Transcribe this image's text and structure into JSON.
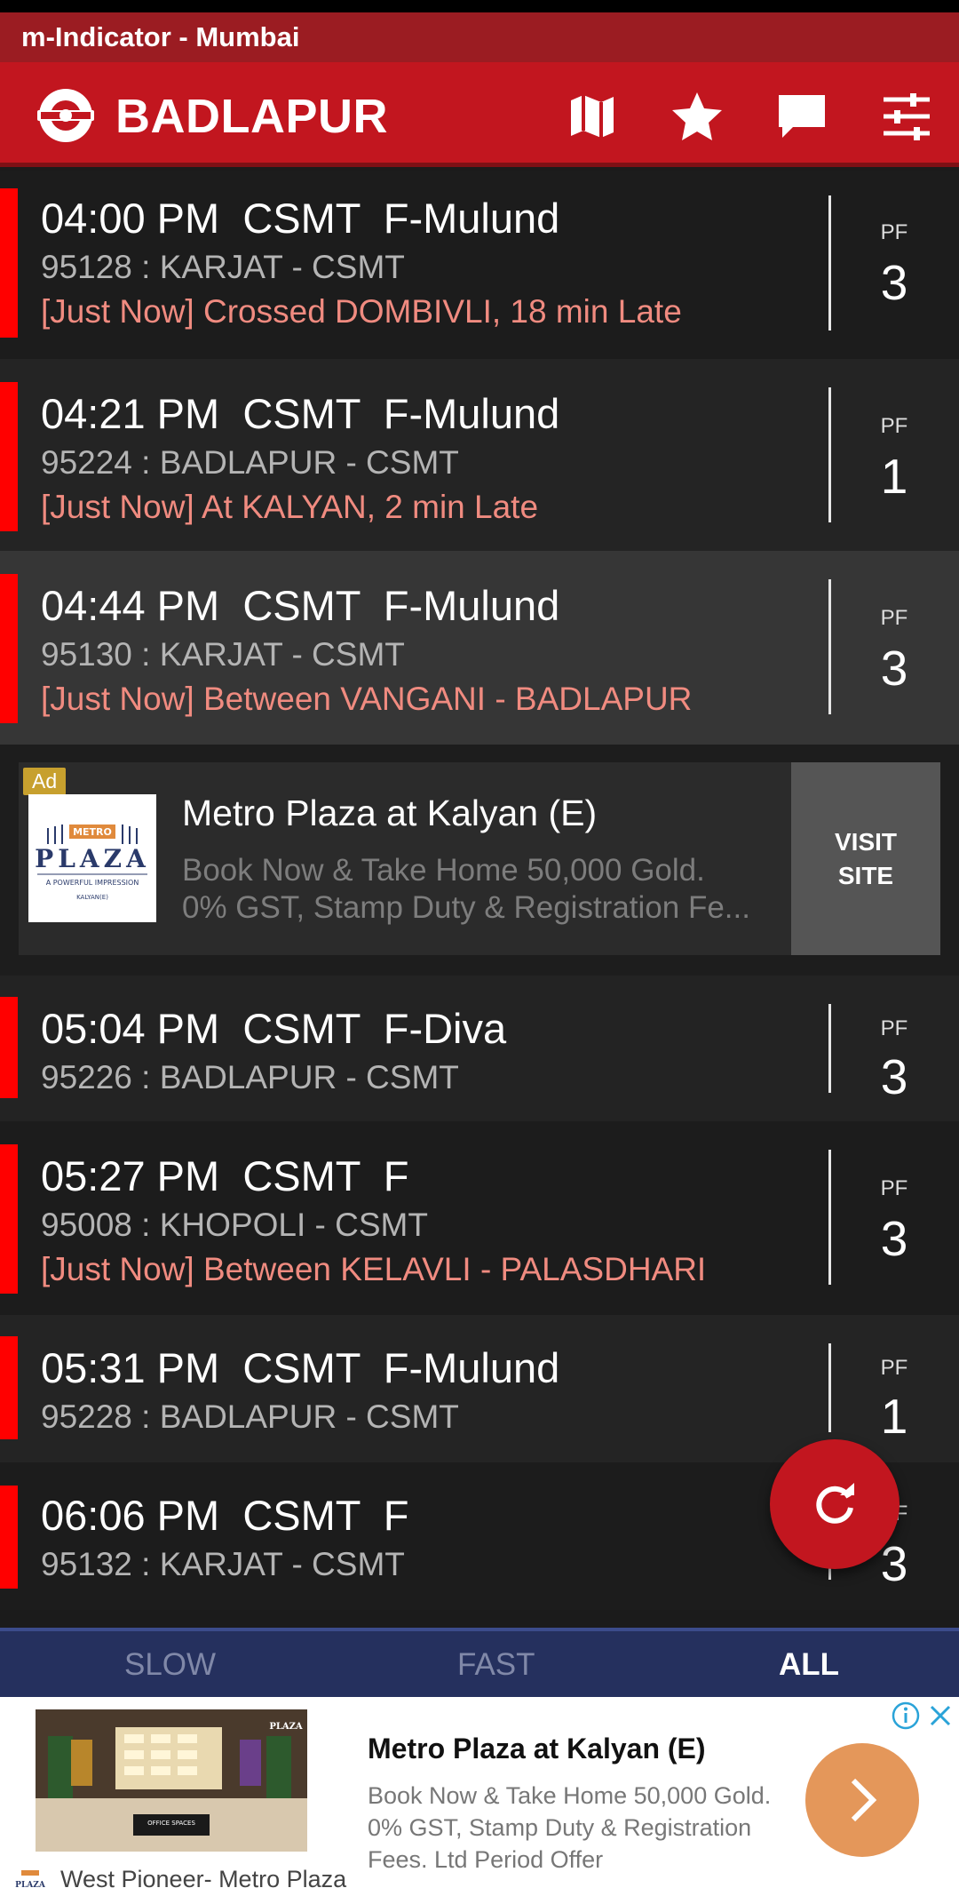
{
  "app": {
    "title": "m-Indicator - Mumbai",
    "station": "BADLAPUR"
  },
  "toolbar_icons": [
    "train-logo-icon",
    "map-icon",
    "star-icon",
    "chat-icon",
    "settings-sliders-icon"
  ],
  "trains": [
    {
      "time": "04:00 PM",
      "dest": "CSMT",
      "type": "F-Mulund",
      "number": "95128 : KARJAT - CSMT",
      "status": "[Just Now] Crossed DOMBIVLI, 18 min Late",
      "pf_label": "PF",
      "pf": "3"
    },
    {
      "time": "04:21 PM",
      "dest": "CSMT",
      "type": "F-Mulund",
      "number": "95224 : BADLAPUR - CSMT",
      "status": "[Just Now] At KALYAN, 2 min Late",
      "pf_label": "PF",
      "pf": "1"
    },
    {
      "time": "04:44 PM",
      "dest": "CSMT",
      "type": "F-Mulund",
      "number": "95130 : KARJAT - CSMT",
      "status": "[Just Now] Between VANGANI - BADLAPUR",
      "pf_label": "PF",
      "pf": "3"
    },
    {
      "time": "05:04 PM",
      "dest": "CSMT",
      "type": "F-Diva",
      "number": "95226 : BADLAPUR - CSMT",
      "status": "",
      "pf_label": "PF",
      "pf": "3"
    },
    {
      "time": "05:27 PM",
      "dest": "CSMT",
      "type": "F",
      "number": "95008 : KHOPOLI - CSMT",
      "status": "[Just Now] Between KELAVLI - PALASDHARI",
      "pf_label": "PF",
      "pf": "3"
    },
    {
      "time": "05:31 PM",
      "dest": "CSMT",
      "type": "F-Mulund",
      "number": "95228 : BADLAPUR - CSMT",
      "status": "",
      "pf_label": "PF",
      "pf": "1"
    },
    {
      "time": "06:06 PM",
      "dest": "CSMT",
      "type": "F",
      "number": "95132 : KARJAT - CSMT",
      "status": "",
      "pf_label": "PF",
      "pf": "3"
    }
  ],
  "ad": {
    "tag": "Ad",
    "logo_text": "METRO",
    "logo_brand": "PLAZA",
    "logo_tagline": "A POWERFUL IMPRESSION",
    "logo_location": "KALYAN(E)",
    "title": "Metro Plaza at Kalyan (E)",
    "desc1": "Book Now & Take Home 50,000 Gold.",
    "desc2": "0% GST, Stamp Duty & Registration Fe...",
    "cta": "VISIT SITE"
  },
  "tabs": [
    {
      "label": "SLOW",
      "active": false
    },
    {
      "label": "FAST",
      "active": false
    },
    {
      "label": "ALL",
      "active": true
    }
  ],
  "bottom_ad": {
    "title": "Metro Plaza at Kalyan (E)",
    "desc1": "Book Now & Take Home 50,000 Gold.",
    "desc2": "0% GST, Stamp Duty & Registration",
    "desc3": "Fees. Ltd Period Offer",
    "advertiser": "West Pioneer- Metro Plaza",
    "image_caption": "OFFICE SPACES",
    "image_brand": "PLAZA"
  },
  "colors": {
    "header": "#c2161f",
    "titlebar": "#9b1c22",
    "row_accent": "#ff0000",
    "status_text": "#f08b80",
    "tabs_bg": "#25305e",
    "fab": "#c2161f",
    "cta_orange": "#e4975a"
  }
}
